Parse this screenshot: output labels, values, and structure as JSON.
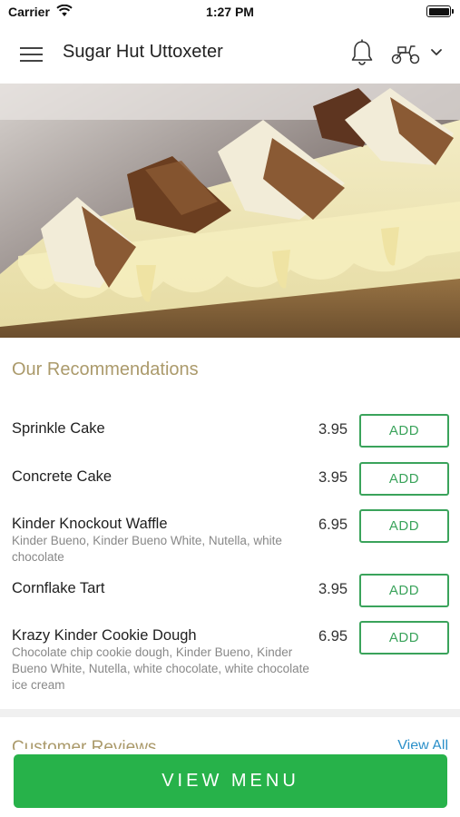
{
  "status_bar": {
    "carrier": "Carrier",
    "time": "1:27 PM"
  },
  "header": {
    "title": "Sugar Hut Uttoxeter",
    "icons": [
      "menu-icon",
      "bell-icon",
      "scooter-icon",
      "chevron-down-icon"
    ]
  },
  "recommendations": {
    "title": "Our Recommendations",
    "add_label": "ADD",
    "items": [
      {
        "name": "Sprinkle Cake",
        "description": "",
        "price": "3.95"
      },
      {
        "name": "Concrete Cake",
        "description": "",
        "price": "3.95"
      },
      {
        "name": "Kinder Knockout Waffle",
        "description": "Kinder Bueno, Kinder Bueno White, Nutella, white chocolate",
        "price": "6.95"
      },
      {
        "name": "Cornflake Tart",
        "description": "",
        "price": "3.95"
      },
      {
        "name": "Krazy Kinder Cookie Dough",
        "description": "Chocolate chip cookie dough, Kinder Bueno, Kinder Bueno White, Nutella, white chocolate, white chocolate ice cream",
        "price": "6.95"
      }
    ]
  },
  "reviews": {
    "title": "Customer Reviews",
    "view_all": "View All"
  },
  "footer": {
    "view_menu": "VIEW MENU"
  },
  "colors": {
    "accent_green": "#27b24a",
    "add_green": "#3aa35b",
    "section_gold": "#ab9a6b",
    "link_blue": "#2a8fc9"
  }
}
